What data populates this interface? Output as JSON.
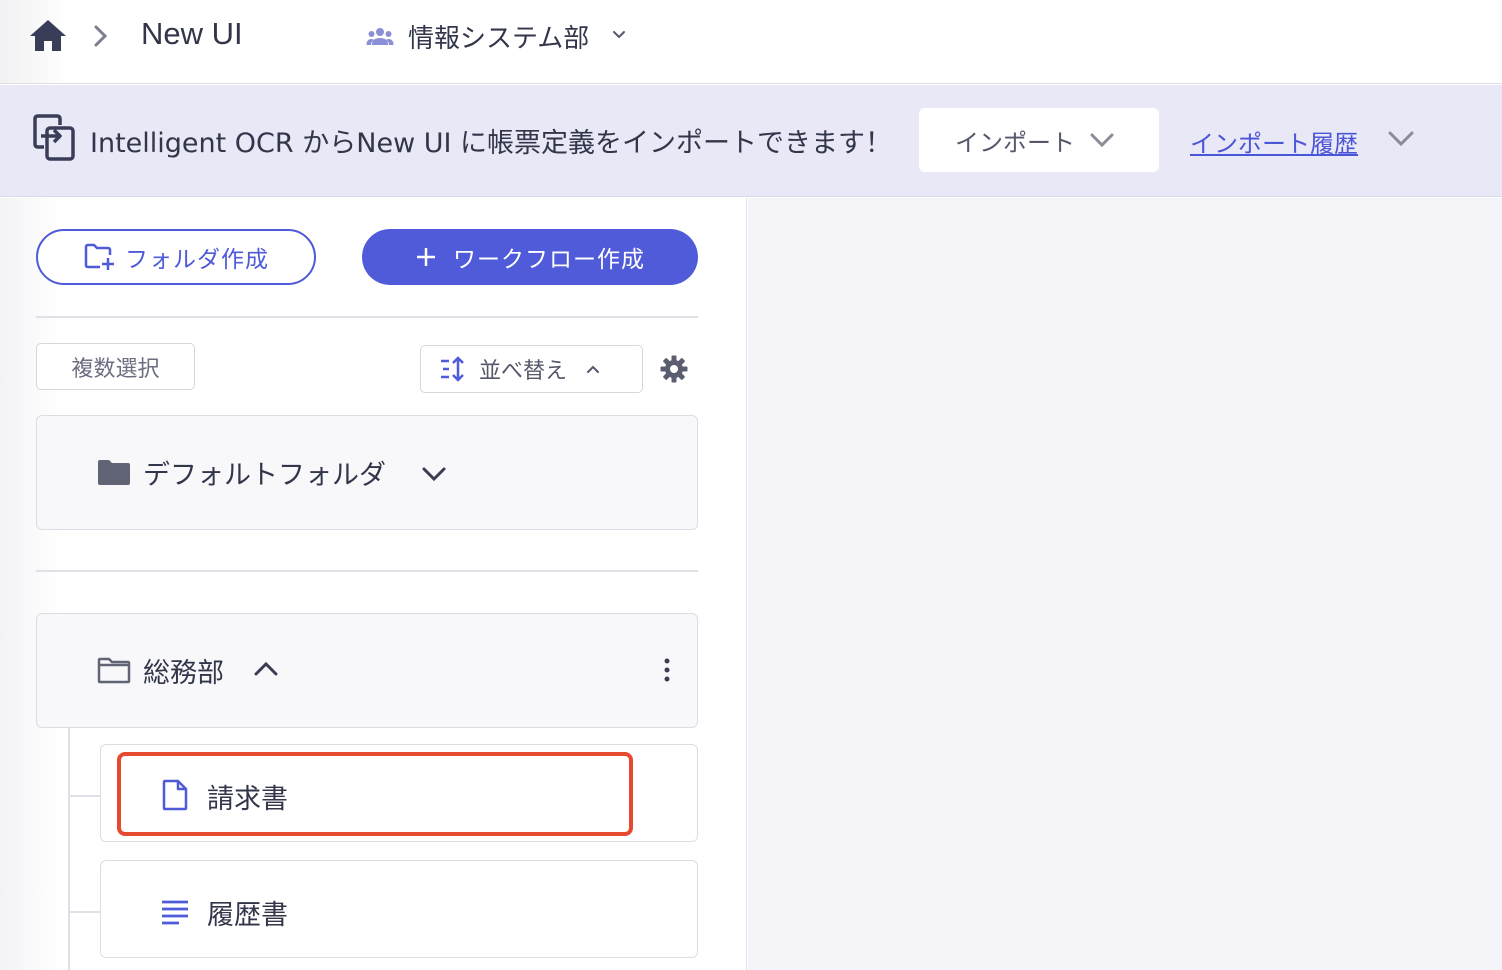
{
  "header": {
    "app_title": "New UI",
    "department": "情報システム部",
    "icons": [
      "home-icon",
      "chevron-right-icon",
      "team-icon",
      "chevron-down-icon"
    ]
  },
  "banner": {
    "message": "Intelligent OCR からNew UI に帳票定義をインポートできます！",
    "import_label": "インポート",
    "history_link": "インポート履歴"
  },
  "toolbar": {
    "create_folder": "フォルダ作成",
    "create_workflow": "ワークフロー作成",
    "multi_select": "複数選択",
    "sort": "並べ替え"
  },
  "folders": {
    "default": {
      "label": "デフォルトフォルダ",
      "expanded": false
    },
    "general_affairs": {
      "label": "総務部",
      "expanded": true,
      "items": [
        {
          "label": "請求書",
          "icon": "document-icon",
          "highlighted": true
        },
        {
          "label": "履歴書",
          "icon": "list-lines-icon",
          "highlighted": false
        }
      ]
    }
  },
  "colors": {
    "accent": "#4f5bd8",
    "banner_bg": "#e8e8f6",
    "highlight": "#e84a2f",
    "text": "#32364a"
  }
}
